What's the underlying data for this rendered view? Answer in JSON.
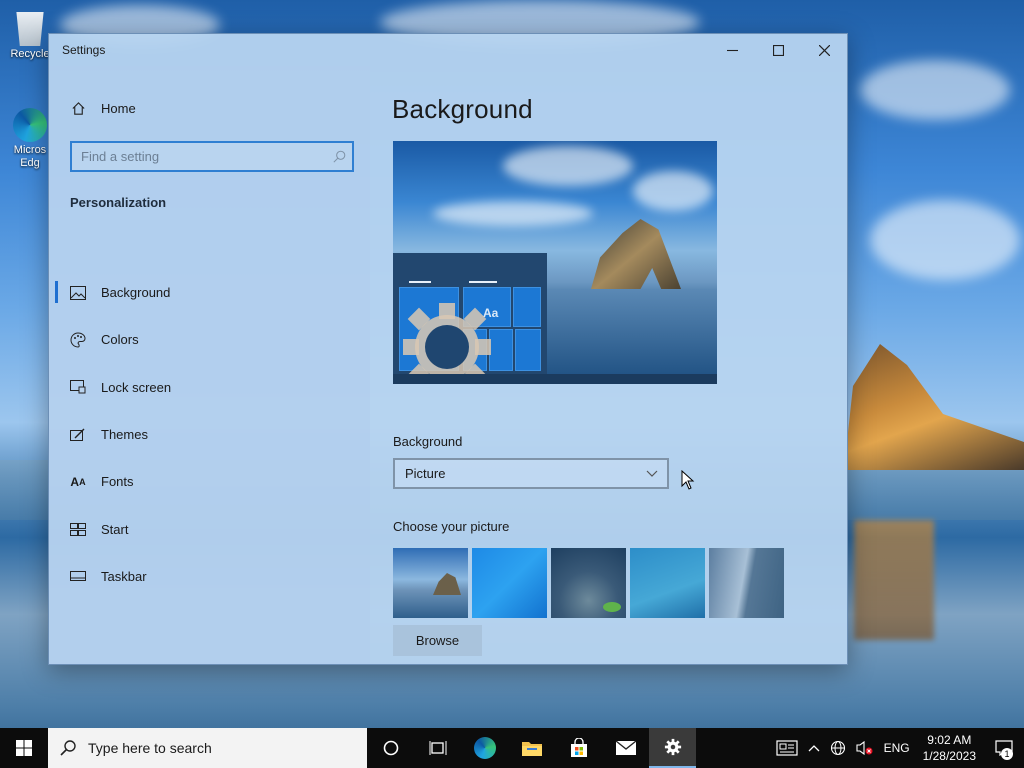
{
  "desktop": {
    "icons": [
      {
        "label": "Recycle"
      },
      {
        "label": "Micros Edg"
      }
    ]
  },
  "window": {
    "title": "Settings",
    "controls": {
      "minimize": "—",
      "maximize": "☐",
      "close": "✕"
    }
  },
  "sidebar": {
    "home_label": "Home",
    "search_placeholder": "Find a setting",
    "section_title": "Personalization",
    "items": [
      {
        "label": "Background",
        "icon": "picture-icon",
        "active": true
      },
      {
        "label": "Colors",
        "icon": "palette-icon"
      },
      {
        "label": "Lock screen",
        "icon": "lock-screen-icon"
      },
      {
        "label": "Themes",
        "icon": "brush-icon"
      },
      {
        "label": "Fonts",
        "icon": "font-icon"
      },
      {
        "label": "Start",
        "icon": "start-tiles-icon"
      },
      {
        "label": "Taskbar",
        "icon": "taskbar-icon"
      }
    ]
  },
  "main": {
    "title": "Background",
    "preview": {
      "sample_text": "Aa"
    },
    "background_label": "Background",
    "background_value": "Picture",
    "choose_label": "Choose your picture",
    "browse_label": "Browse"
  },
  "taskbar": {
    "search_placeholder": "Type here to search",
    "lang": "ENG",
    "time": "9:02 AM",
    "date": "1/28/2023",
    "notification_count": "1"
  }
}
